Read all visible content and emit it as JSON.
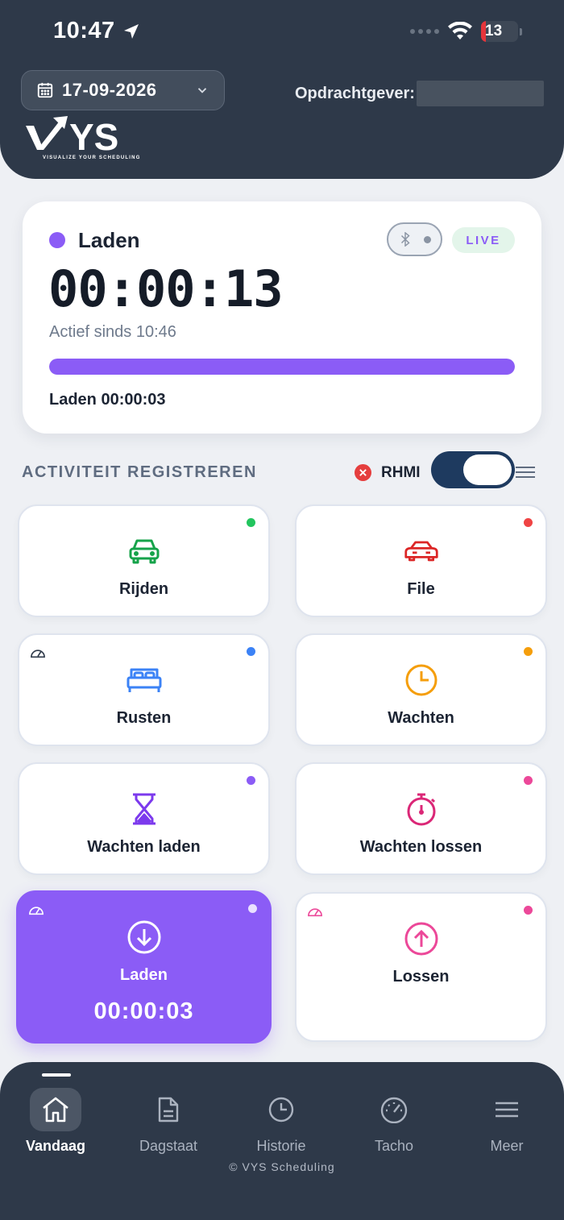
{
  "status_bar": {
    "time": "10:47",
    "battery": "13"
  },
  "header": {
    "date": "17-09-2026",
    "client_label": "Opdrachtgever:",
    "logo_text": "YS",
    "logo_tagline": "VISUALIZE YOUR SCHEDULING"
  },
  "timer_card": {
    "activity": "Laden",
    "live_badge": "LIVE",
    "elapsed": "00:00:13",
    "active_since": "Actief sinds 10:46",
    "progress_percent": 100,
    "sub_timer": "Laden 00:00:03"
  },
  "section": {
    "title": "ACTIVITEIT REGISTREREN",
    "rhmi_label": "RHMI"
  },
  "activities": [
    {
      "label": "Rijden",
      "color": "#16a34a",
      "dot": "#22c55e",
      "icon": "car-icon"
    },
    {
      "label": "File",
      "color": "#dc2626",
      "dot": "#ef4444",
      "icon": "traffic-car-icon"
    },
    {
      "label": "Rusten",
      "color": "#3b82f6",
      "dot": "#3b82f6",
      "icon": "bed-icon"
    },
    {
      "label": "Wachten",
      "color": "#f59e0b",
      "dot": "#f59e0b",
      "icon": "clock-icon"
    },
    {
      "label": "Wachten laden",
      "color": "#7c3aed",
      "dot": "#8b5cf6",
      "icon": "hourglass-icon"
    },
    {
      "label": "Wachten lossen",
      "color": "#db2777",
      "dot": "#ec4899",
      "icon": "stopwatch-icon"
    },
    {
      "label": "Laden",
      "color": "#ffffff",
      "dot": "#e9e0ff",
      "icon": "arrow-down-circle-icon",
      "timer": "00:00:03"
    },
    {
      "label": "Lossen",
      "color": "#ec4899",
      "dot": "#ec4899",
      "icon": "arrow-up-circle-icon"
    }
  ],
  "bottom_nav": {
    "items": [
      {
        "label": "Vandaag",
        "icon": "home-icon"
      },
      {
        "label": "Dagstaat",
        "icon": "document-icon"
      },
      {
        "label": "Historie",
        "icon": "clock-icon"
      },
      {
        "label": "Tacho",
        "icon": "gauge-icon"
      },
      {
        "label": "Meer",
        "icon": "menu-icon"
      }
    ],
    "copyright": "© VYS Scheduling"
  }
}
